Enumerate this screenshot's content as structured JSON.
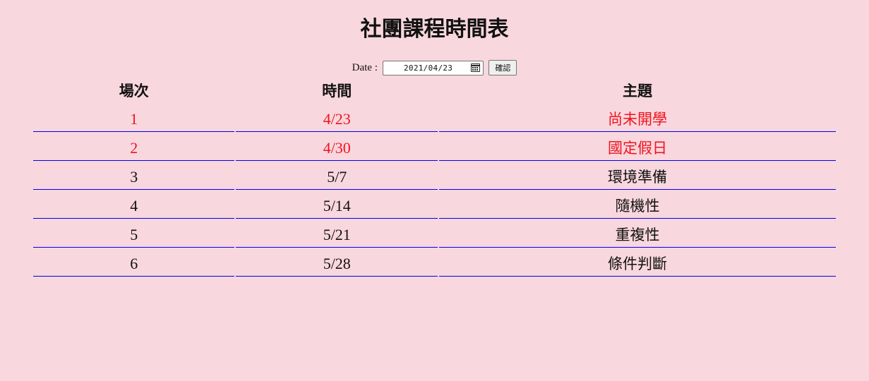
{
  "page": {
    "title": "社團課程時間表"
  },
  "date_picker": {
    "label": "Date :",
    "value": "2021/04/23",
    "confirm_label": "確認"
  },
  "table": {
    "headers": [
      "場次",
      "時間",
      "主題"
    ],
    "rows": [
      {
        "session": "1",
        "date": "4/23",
        "topic": "尚未開學",
        "highlight": true
      },
      {
        "session": "2",
        "date": "4/30",
        "topic": "國定假日",
        "highlight": true
      },
      {
        "session": "3",
        "date": "5/7",
        "topic": "環境準備",
        "highlight": false
      },
      {
        "session": "4",
        "date": "5/14",
        "topic": "隨機性",
        "highlight": false
      },
      {
        "session": "5",
        "date": "5/21",
        "topic": "重複性",
        "highlight": false
      },
      {
        "session": "6",
        "date": "5/28",
        "topic": "條件判斷",
        "highlight": false
      }
    ]
  },
  "colors": {
    "background": "#f8d7de",
    "highlight_text": "#f2131d",
    "row_border": "#0000ee"
  },
  "icons": {
    "date_picker": "calendar-icon"
  }
}
